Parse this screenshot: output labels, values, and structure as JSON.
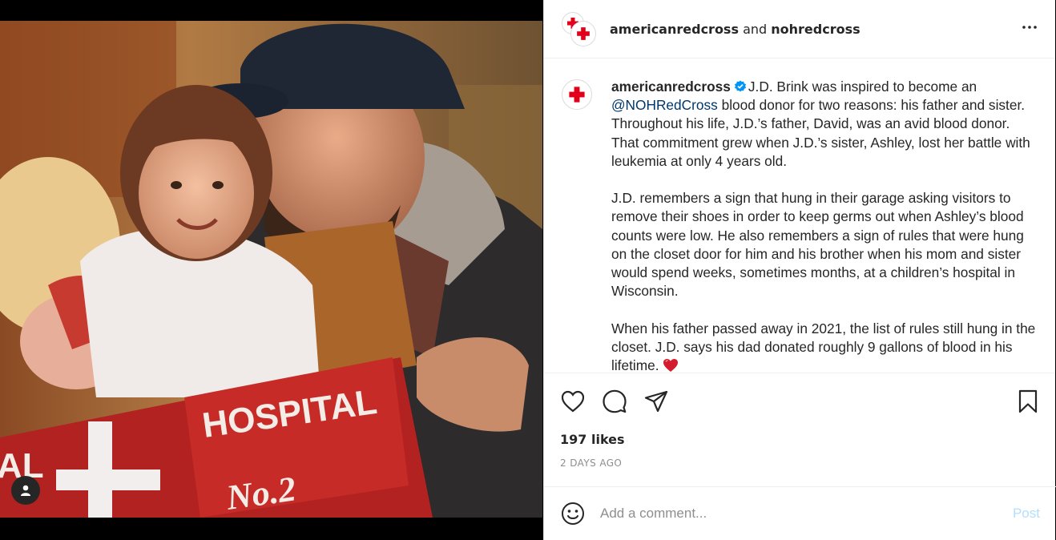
{
  "post": {
    "header": {
      "author": "americanredcross",
      "joiner": " and ",
      "collaborator": "nohredcross",
      "more_icon": "more-horizontal-icon"
    },
    "caption": {
      "username": "americanredcross",
      "verified_icon": "verified-badge-icon",
      "p1_start": "J.D. Brink was inspired to become an ",
      "p1_mention": "@NOHRedCross",
      "p1_end": " blood donor for two reasons: his father and sister. Throughout his life, J.D.’s father, David, was an avid blood donor. That commitment grew when J.D.’s sister, Ashley, lost her battle with leukemia at only 4 years old.",
      "p2": "J.D. remembers a sign that hung in their garage asking visitors to remove their shoes in order to keep germs out when Ashley’s blood counts were low. He also remembers a sign of rules that were hung on the closet door for him and his brother when his mom and sister would spend weeks, sometimes months, at a children’s hospital in Wisconsin.",
      "p3": "When his father passed away in 2021, the list of rules still hung in the closet. J.D. says his dad donated roughly 9 gallons of blood in his lifetime.",
      "p3_emoji": "❤️"
    },
    "photo": {
      "sign_word": "HOSPITAL",
      "sign_number": "No.2",
      "sign_partial": "AL"
    },
    "likes": "197 likes",
    "timestamp": "2 DAYS AGO",
    "comment": {
      "placeholder": "Add a comment...",
      "post_label": "Post"
    }
  },
  "colors": {
    "red_cross": "#e3001b",
    "mention": "#00376b",
    "verified": "#0095f6",
    "post_disabled": "#b2dffc",
    "heart_emoji": "#d41c2e"
  }
}
